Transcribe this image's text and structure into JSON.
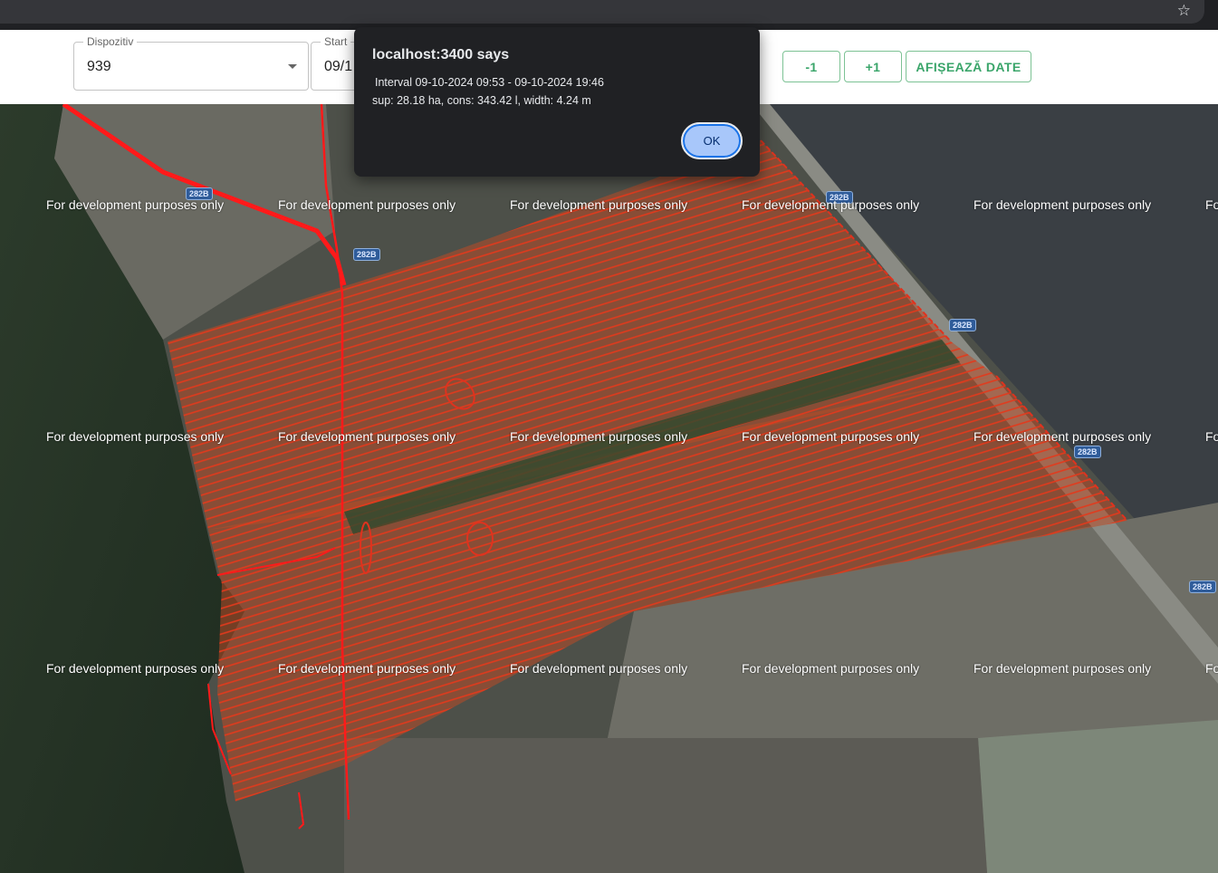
{
  "browser": {
    "star_icon": "star-icon"
  },
  "toolbar": {
    "device": {
      "label": "Dispozitiv",
      "value": "939"
    },
    "start": {
      "label": "Start",
      "value": "09/1"
    },
    "btn_minus": "-1",
    "btn_plus": "+1",
    "btn_show": "AFIȘEAZĂ DATE"
  },
  "dialog": {
    "title": "localhost:3400 says",
    "line1": "Interval 09-10-2024 09:53 - 09-10-2024 19:46",
    "line2": "sup: 28.18 ha, cons: 343.42 l, width: 4.24 m",
    "ok": "OK"
  },
  "map": {
    "watermark": "For development purposes only",
    "watermark_partial": "Fo",
    "road_label": "282B",
    "colors": {
      "track": "#e8231e",
      "coverage": "#c8351c",
      "road": "#ff2020"
    }
  }
}
